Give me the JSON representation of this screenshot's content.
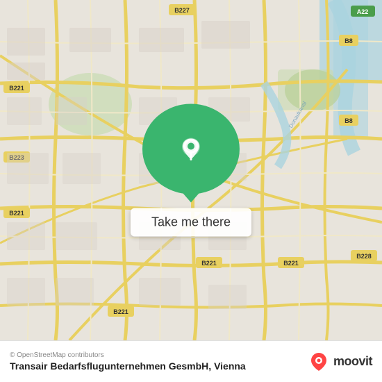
{
  "map": {
    "alt": "Map of Vienna",
    "osm_credit": "© OpenStreetMap contributors",
    "accent_color": "#3ab56e"
  },
  "button": {
    "label": "Take me there"
  },
  "footer": {
    "place_name": "Transair Bedarfsflugunternehmen GesmbH, Vienna",
    "moovit_label": "moovit"
  }
}
